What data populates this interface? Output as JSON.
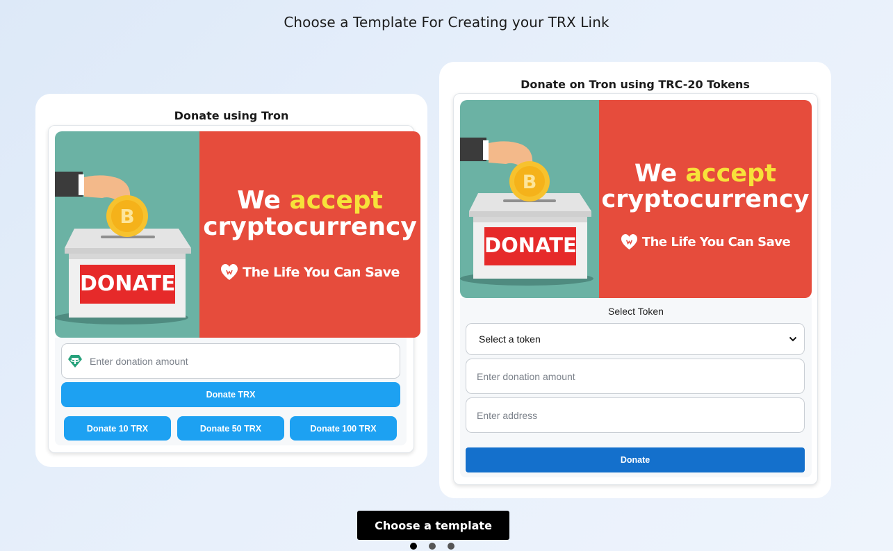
{
  "page": {
    "title": "Choose a Template For Creating your TRX Link"
  },
  "template1": {
    "title": "Donate using Tron",
    "banner": {
      "we": "We ",
      "accept": "accept",
      "crypto": "cryptocurrency",
      "donate_sign": "DONATE",
      "brand": "The Life You Can Save"
    },
    "amount_placeholder": "Enter donation amount",
    "donate_btn": "Donate TRX",
    "quick": [
      "Donate 10 TRX",
      "Donate 50 TRX",
      "Donate 100 TRX"
    ]
  },
  "template2": {
    "title": "Donate on Tron using TRC-20 Tokens",
    "banner": {
      "we": "We ",
      "accept": "accept",
      "crypto": "cryptocurrency",
      "donate_sign": "DONATE",
      "brand": "The Life You Can Save"
    },
    "select_label": "Select Token",
    "select_value": "Select a token",
    "amount_placeholder": "Enter donation amount",
    "address_placeholder": "Enter address",
    "donate_btn": "Donate"
  },
  "footer": {
    "choose_btn": "Choose a template"
  },
  "colors": {
    "accent_blue": "#1da1f2",
    "banner_red": "#e64c3c",
    "banner_teal": "#6bb2a4",
    "accent_yellow": "#f7e23a"
  },
  "icons": {
    "tether": "tether-icon",
    "dropdown": "chevron-down-icon",
    "heart": "heart-hands-icon",
    "bitcoin": "bitcoin-coin-icon"
  }
}
